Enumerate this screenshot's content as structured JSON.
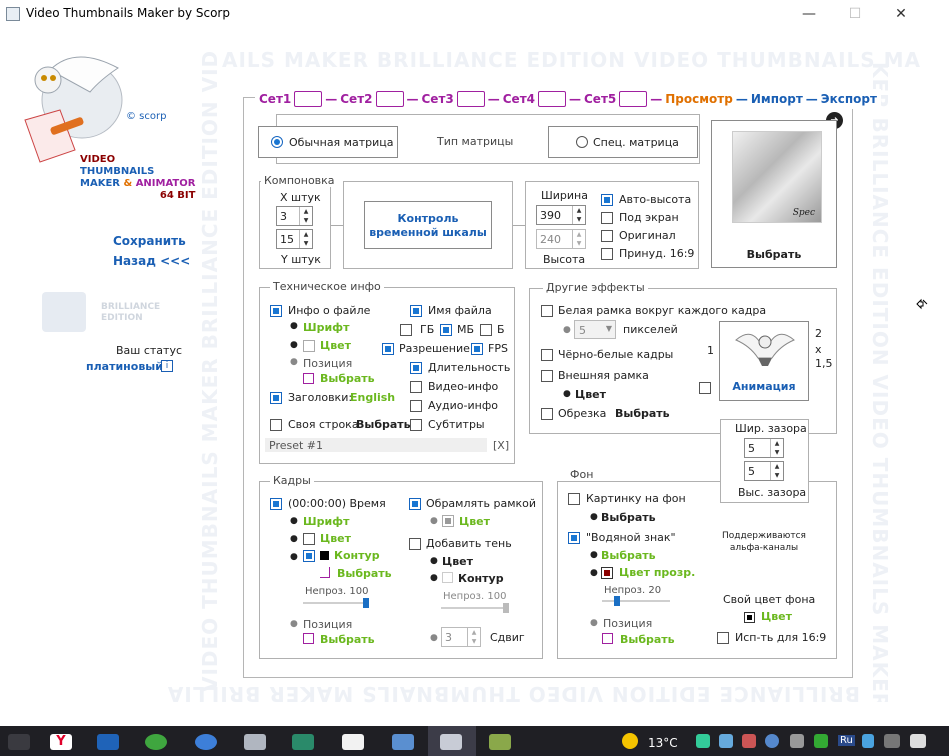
{
  "window": {
    "title": "Video Thumbnails Maker by Scorp",
    "minimize": "—",
    "maximize": "☐",
    "close": "✕"
  },
  "watermark": {
    "top": "AILS MAKER BRILLIANCE EDITION VIDEO THUMBNAILS MA",
    "left": "VIDEO THUMBNAILS MAKER BRILLIANCE EDITION VIDEO THUMBNAILS MA",
    "right": "KER BRILLIANCE EDITION VIDEO THUMBNAILS MAKER",
    "bottom": "BRILLIANCE EDITION VIDEO THUMBNAILS MAKER BRILLIA"
  },
  "sidebar": {
    "copyright": "© scorp",
    "logo_lines": [
      "VIDEO",
      "THUMBNAILS",
      "MAKER",
      "&",
      "ANIMATOR",
      "64 BIT"
    ],
    "save": "Сохранить",
    "back": "Назад <<<",
    "edition": "BRILLIANCE\nEDITION",
    "status_label": "Ваш статус",
    "status_value": "платиновый",
    "info_icon": "i"
  },
  "sets": {
    "items": [
      "Сет1",
      "Сет2",
      "Сет3",
      "Сет4",
      "Сет5"
    ],
    "preview": "Просмотр",
    "import": "Импорт",
    "export": "Экспорт",
    "sep": "—"
  },
  "matrix": {
    "normal": "Обычная матрица",
    "type_label": "Тип матрицы",
    "special": "Спец. матрица"
  },
  "layout": {
    "title": "Компоновка",
    "x_label": "X штук",
    "x_value": "3",
    "y_value": "15",
    "y_label": "Y штук",
    "timeline_btn": "Контроль временной шкалы"
  },
  "size": {
    "width_label": "Ширина",
    "width_value": "390",
    "height_value": "240",
    "height_label": "Высота",
    "auto_height": "Авто-высота",
    "fit_screen": "Под экран",
    "original": "Оригинал",
    "force_169": "Принуд. 16:9"
  },
  "preview_panel": {
    "select": "Выбрать",
    "spec": "Spec"
  },
  "tech": {
    "title": "Техническое инфо",
    "file_info": "Инфо о файле",
    "font": "Шрифт",
    "color": "Цвет",
    "position": "Позиция",
    "select": "Выбрать",
    "headers": "Заголовки:",
    "headers_lang": "English",
    "own_line": "Своя строка",
    "own_select": "Выбрать",
    "preset": "Preset #1",
    "preset_x": "[X]",
    "file_name": "Имя файла",
    "gb": "ГБ",
    "mb": "МБ",
    "b": "Б",
    "resolution": "Разрешение /",
    "fps": "FPS",
    "duration": "Длительность",
    "video_info": "Видео-инфо",
    "audio_info": "Аудио-инфо",
    "subtitles": "Субтитры"
  },
  "effects": {
    "title": "Другие эффекты",
    "white_frame": "Белая рамка вокруг каждого кадра",
    "pixels_value": "5",
    "pixels": "пикселей",
    "bw": "Чёрно-белые кадры",
    "outer_frame": "Внешняя рамка",
    "color": "Цвет",
    "crop": "Обрезка",
    "crop_select": "Выбрать",
    "one": "1",
    "ratio": [
      "2",
      "x",
      "1,5"
    ],
    "animation": "Анимация",
    "gap_w": "Шир. зазора",
    "gap_w_value": "5",
    "gap_h_value": "5",
    "gap_h": "Выс. зазора"
  },
  "frames": {
    "title": "Кадры",
    "time": "(00:00:00) Время",
    "font": "Шрифт",
    "color": "Цвет",
    "contour": "Контур",
    "select": "Выбрать",
    "opacity": "Непроз.",
    "opacity_value": "100",
    "position": "Позиция",
    "pos_select": "Выбрать",
    "frame_border": "Обрамлять рамкой",
    "border_color": "Цвет",
    "shadow": "Добавить тень",
    "shadow_color": "Цвет",
    "shadow_contour": "Контур",
    "shadow_opacity": "Непроз.",
    "shadow_opacity_value": "100",
    "shift_value": "3",
    "shift": "Сдвиг",
    "opacity_level": 1.0,
    "shadow_opacity_level": 1.0
  },
  "bg": {
    "title": "Фон",
    "picture": "Картинку на фон",
    "picture_select": "Выбрать",
    "watermark": "\"Водяной знак\"",
    "wm_select": "Выбрать",
    "wm_color": "Цвет прозр.",
    "opacity": "Непроз.",
    "opacity_value": "20",
    "position": "Позиция",
    "pos_select": "Выбрать",
    "alpha_note": "Поддерживаются\nальфа-каналы",
    "own_color": "Свой цвет фона",
    "own_color_btn": "Цвет",
    "use_169": "Исп-ть для 16:9",
    "opacity_level": 0.2
  },
  "taskbar": {
    "temp": "13°C",
    "lang": "Ru"
  },
  "colors": {
    "set_purple": "#a020a0",
    "preview_orange": "#e07000",
    "import_blue": "#1a5fb4",
    "green": "#6bb81f",
    "nav_blue": "#1a5fb4",
    "accent": "#1976d2"
  }
}
